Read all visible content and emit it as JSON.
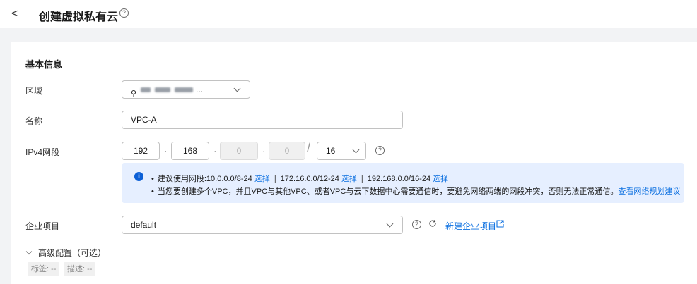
{
  "header": {
    "back_icon": "chevron-left-icon",
    "title": "创建虚拟私有云",
    "help_icon": "help-circle-icon"
  },
  "basic": {
    "section_title": "基本信息",
    "region_label": "区域",
    "region_value": "...",
    "name_label": "名称",
    "name_value": "VPC-A",
    "ipv4_label": "IPv4网段",
    "octets": [
      "192",
      "168",
      "0",
      "0"
    ],
    "mask": "16",
    "dot": "·",
    "slash": "/"
  },
  "info": {
    "icon": "info-icon",
    "bullet": "•",
    "line1_prefix": "建议使用网段:10.0.0.0/8-24",
    "select_label": "选择",
    "line1_seg2": "172.16.0.0/12-24",
    "line1_seg3": "192.168.0.0/16-24",
    "pipe": "|",
    "line2_text": "当您要创建多个VPC，并且VPC与其他VPC、或者VPC与云下数据中心需要通信时，要避免网络两端的网段冲突，否则无法正常通信。",
    "line2_link": "查看网络规划建议"
  },
  "enterprise": {
    "label": "企业项目",
    "value": "default",
    "refresh_icon": "refresh-icon",
    "new_link": "新建企业项目",
    "external_icon": "external-link-icon"
  },
  "advanced": {
    "toggle_label": "高级配置（可选）",
    "tag_label": "标签: --",
    "desc_label": "描述: --"
  },
  "colors": {
    "accent": "#0b6fe0",
    "info_bg": "#e6efff",
    "page_bg": "#f2f3f5"
  }
}
